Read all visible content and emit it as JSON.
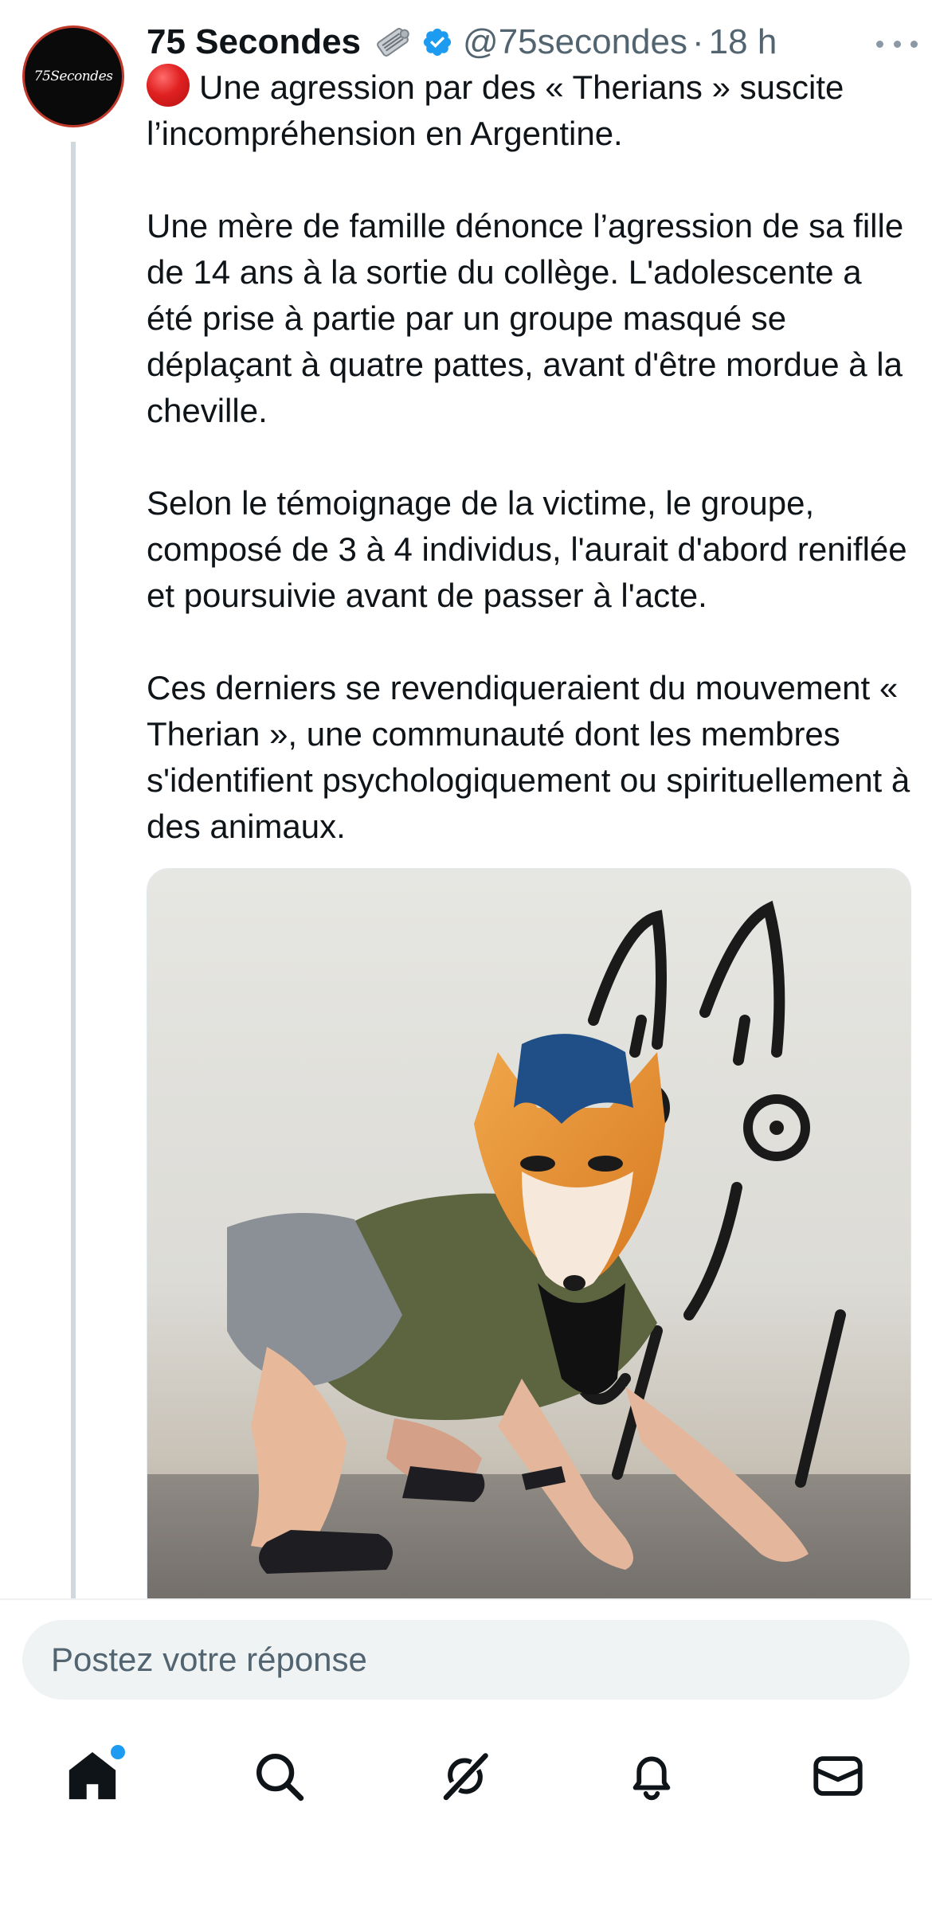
{
  "tweet": {
    "avatar_text": "75Secondes",
    "display_name": "75 Secondes",
    "name_emoji": "newspaper-icon",
    "verified": true,
    "handle": "@75secondes",
    "separator": "·",
    "time": "18 h",
    "paragraphs": [
      "Une agression par des « Therians » suscite l’incompréhension en Argentine.",
      "Une mère de famille dénonce l’agression de sa fille de 14 ans à la sortie du collège. L'adolescente a été prise à partie par un groupe masqué se déplaçant à quatre pattes, avant d'être mordue à la cheville.",
      "Selon le témoignage de la victime, le groupe, composé de 3 à 4 individus, l'aurait d'abord reniflée et poursuivie avant de passer à l'acte.",
      "Ces derniers se revendiqueraient du mouvement « Therian », une communauté dont les membres s'identifient psychologiquement ou spirituellement à des animaux."
    ],
    "lead_emoji": "red-circle-icon",
    "media": "photo"
  },
  "reply": {
    "placeholder": "Postez votre réponse"
  },
  "tabbar": {
    "items": [
      "home-icon",
      "search-icon",
      "grok-icon",
      "bell-icon",
      "mail-icon"
    ],
    "home_has_notification": true
  },
  "colors": {
    "accent": "#1d9bf0",
    "text": "#0f1419",
    "secondary": "#536471",
    "thread_line": "#cfd9de",
    "reply_bg": "#eff3f4"
  }
}
